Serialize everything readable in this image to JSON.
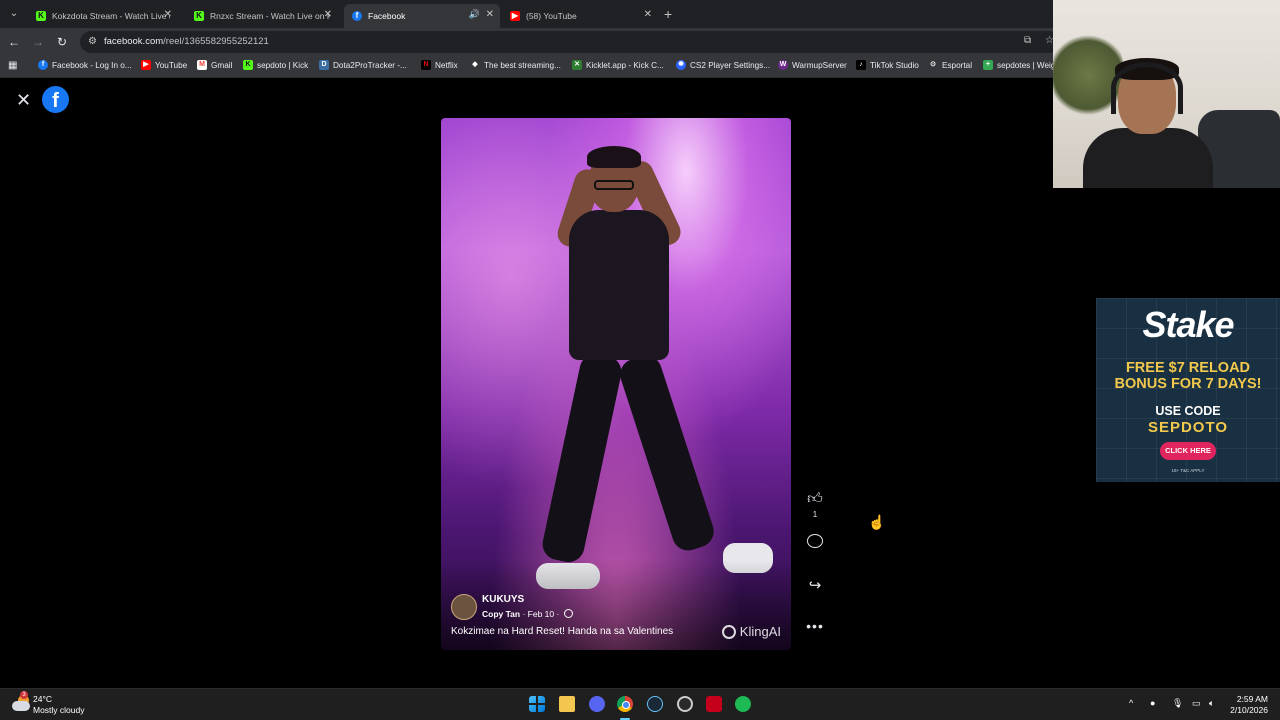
{
  "browser": {
    "tabs": [
      {
        "title": "Kokzdota Stream - Watch Live on Kick",
        "icon": "kick-icon"
      },
      {
        "title": "Rnzxc Stream - Watch Live on Kick",
        "icon": "kick-icon"
      },
      {
        "title": "Facebook",
        "icon": "facebook-icon",
        "active": true,
        "audio": true
      },
      {
        "title": "(58) YouTube",
        "icon": "youtube-icon"
      }
    ],
    "url_prefix": "facebook.com",
    "url_path": "/reel/1365582955252121",
    "bookmarks": [
      "Facebook - Log In o...",
      "YouTube",
      "Gmail",
      "sepdoto | Kick",
      "Dota2ProTracker -...",
      "Netflix",
      "The best streaming...",
      "Kicklet.app - Kick C...",
      "CS2 Player Settings...",
      "WarmupServer",
      "TikTok Studio",
      "Esportal",
      "sepdotes | Weig"
    ]
  },
  "reel": {
    "author": "KUKUYS",
    "attribution": "Copy Tan",
    "date": "Feb 10",
    "caption": "Kokzimae na Hard Reset! Handa na sa Valentines",
    "watermark": "KlingAI",
    "like_count": "1"
  },
  "ad": {
    "brand": "Stake",
    "line1": "FREE $7 RELOAD",
    "line2": "BONUS FOR 7 DAYS!",
    "line3": "USE CODE",
    "code": "SEPDOTO",
    "cta": "CLICK HERE",
    "fine": "18+ T&C APPLY"
  },
  "taskbar": {
    "temperature": "24°C",
    "condition": "Mostly cloudy",
    "weather_badge": "3",
    "time": "2:59 AM",
    "date": "2/10/2026"
  },
  "colors": {
    "facebook_blue": "#1877f2",
    "ad_gold": "#f2c94c",
    "ad_cta": "#e0245e"
  }
}
